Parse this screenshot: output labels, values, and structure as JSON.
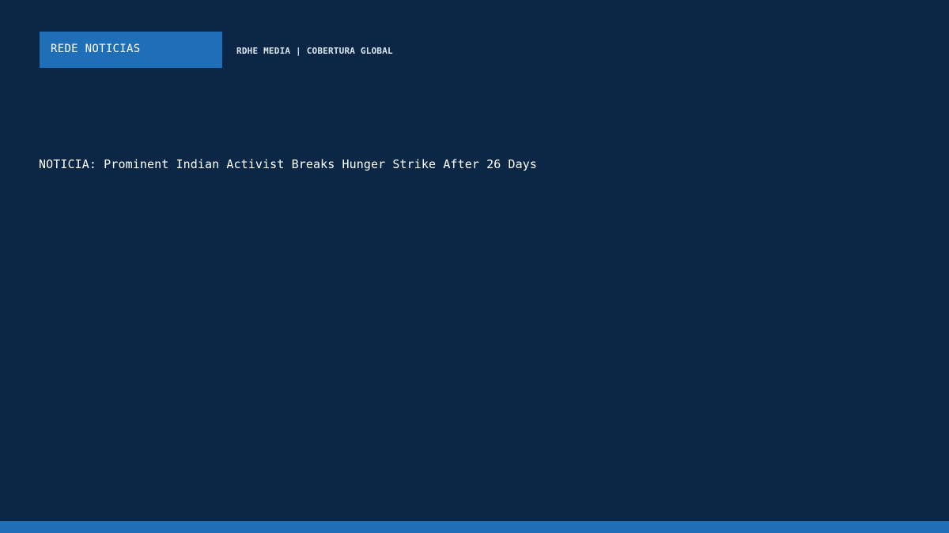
{
  "brand": {
    "name": "REDE NOTICIAS",
    "tagline": "RDHE MEDIA | COBERTURA GLOBAL"
  },
  "headline": {
    "text": "NOTICIA: Prominent Indian Activist Breaks Hunger Strike After 26 Days"
  },
  "colors": {
    "background": "#0b2745",
    "accent": "#1e6eb8",
    "text": "#ffffff"
  }
}
